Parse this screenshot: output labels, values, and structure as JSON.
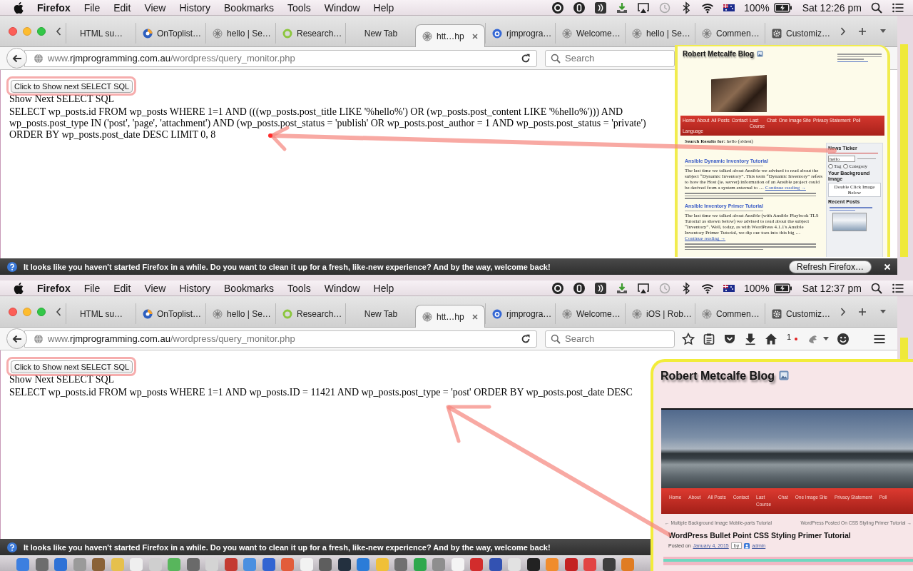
{
  "screens": [
    {
      "menu_bar": {
        "app": "Firefox",
        "menus": [
          "File",
          "Edit",
          "View",
          "History",
          "Bookmarks",
          "Tools",
          "Window",
          "Help"
        ],
        "battery": "100%",
        "clock": "Sat 12:26 pm"
      },
      "tabs": [
        {
          "title": "HTML su…",
          "selected": false
        },
        {
          "title": "OnToplist…",
          "selected": false
        },
        {
          "title": "hello | Se…",
          "selected": false
        },
        {
          "title": "Research…",
          "selected": false
        },
        {
          "title": "New Tab",
          "selected": false
        },
        {
          "title": "htt…hp",
          "selected": true
        },
        {
          "title": "rjmprogra…",
          "selected": false
        },
        {
          "title": "Welcome…",
          "selected": false
        },
        {
          "title": "hello | Se…",
          "selected": false
        },
        {
          "title": "Commen…",
          "selected": false
        },
        {
          "title": "Customiz…",
          "selected": false
        }
      ],
      "address_bar": {
        "prefix": "www.",
        "host": "rjmprogramming.com.au",
        "path": "/wordpress/query_monitor.php"
      },
      "search": {
        "placeholder": "Search"
      },
      "page": {
        "button": "Click to Show next SELECT SQL",
        "heading": "Show Next SELECT SQL",
        "sql": "SELECT wp_posts.id FROM wp_posts WHERE 1=1 AND (((wp_posts.post_title LIKE '%hello%') OR (wp_posts.post_content LIKE '%hello%'))) AND wp_posts.post_type IN ('post', 'page', 'attachment') AND (wp_posts.post_status = 'publish' OR wp_posts.post_author = 1 AND wp_posts.post_status = 'private') ORDER BY wp_posts.post_date DESC LIMIT 0, 8"
      },
      "notification": {
        "message": "It looks like you haven't started Firefox in a while. Do you want to clean it up for a fresh, like-new experience? And by the way, welcome back!",
        "button": "Refresh Firefox…"
      },
      "blog_window": {
        "kind": "search",
        "title": "Robert Metcalfe Blog",
        "nav": [
          "Home",
          "About",
          "All Posts",
          "Contact",
          "Last Course",
          "Chat",
          "One Image Site",
          "Privacy Statement",
          "Poll",
          "Language"
        ],
        "search_heading": "**Search Results for:** hello (oldest)",
        "posts": [
          {
            "title": "Ansible Dynamic Inventory Tutorial",
            "excerpt": "The last time we talked about Ansible we advised to read about the subject “Dynamic Inventory”. This term “Dynamic Inventory” refers to how the Host (ie. server) information of an Ansible project could be derived from a system external to …",
            "more": "Continue reading →"
          },
          {
            "title": "Ansible Inventory Primer Tutorial",
            "excerpt": "The last time we talked about Ansible (with Ansible Playbook TLS Tutorial as shown below) we advised to read about the subject “Inventory”. Well, today, as with WordPress 4.1.1's Ansible Inventory Primer Tutorial, we dip our toes into this big …",
            "more": "Continue reading →"
          }
        ],
        "sidebar": {
          "news_heading": "News Ticker",
          "search_value": "hello",
          "radios": [
            {
              "label": "Tag",
              "selected": false
            },
            {
              "label": "Category",
              "selected": false
            }
          ],
          "background_heading": "Your Background Image",
          "background_button": "Double Click Image Below",
          "recent_heading": "Recent Posts"
        }
      }
    },
    {
      "menu_bar": {
        "app": "Firefox",
        "menus": [
          "File",
          "Edit",
          "View",
          "History",
          "Bookmarks",
          "Tools",
          "Window",
          "Help"
        ],
        "battery": "100%",
        "clock": "Sat 12:37 pm"
      },
      "tabs": [
        {
          "title": "HTML su…",
          "selected": false
        },
        {
          "title": "OnToplist…",
          "selected": false
        },
        {
          "title": "hello | Se…",
          "selected": false
        },
        {
          "title": "Research…",
          "selected": false
        },
        {
          "title": "New Tab",
          "selected": false
        },
        {
          "title": "htt…hp",
          "selected": true
        },
        {
          "title": "rjmprogra…",
          "selected": false
        },
        {
          "title": "Welcome…",
          "selected": false
        },
        {
          "title": "iOS | Rob…",
          "selected": false
        },
        {
          "title": "Commen…",
          "selected": false
        },
        {
          "title": "Customiz…",
          "selected": false
        }
      ],
      "address_bar": {
        "prefix": "www.",
        "host": "rjmprogramming.com.au",
        "path": "/wordpress/query_monitor.php"
      },
      "search": {
        "placeholder": "Search"
      },
      "toolbar": {
        "badge": "1"
      },
      "page": {
        "button": "Click to Show next SELECT SQL",
        "heading": "Show Next SELECT SQL",
        "sql": "SELECT wp_posts.id FROM wp_posts WHERE 1=1 AND wp_posts.ID = 11421 AND wp_posts.post_type = 'post' ORDER BY wp_posts.post_date DESC"
      },
      "notification": {
        "message": "It looks like you haven't started Firefox in a while. Do you want to clean it up for a fresh, like-new experience? And by the way, welcome back!"
      },
      "dock": true,
      "blog_window": {
        "kind": "post",
        "title": "Robert Metcalfe Blog",
        "nav": [
          "Home",
          "About",
          "All Posts",
          "Contact",
          "Last Course",
          "Chat",
          "One Image Site",
          "Privacy Statement",
          "Poll"
        ],
        "prev_link": "← Multiple Background Image Mobile-parts Tutorial",
        "next_link": "WordPress Posted On CSS Styling Primer Tutorial →",
        "post": {
          "heading": "WordPress Bullet Point CSS Styling Primer Tutorial",
          "prefix": "Posted on",
          "date": "January 4, 2015",
          "by": "by",
          "author": "admin"
        }
      }
    }
  ]
}
